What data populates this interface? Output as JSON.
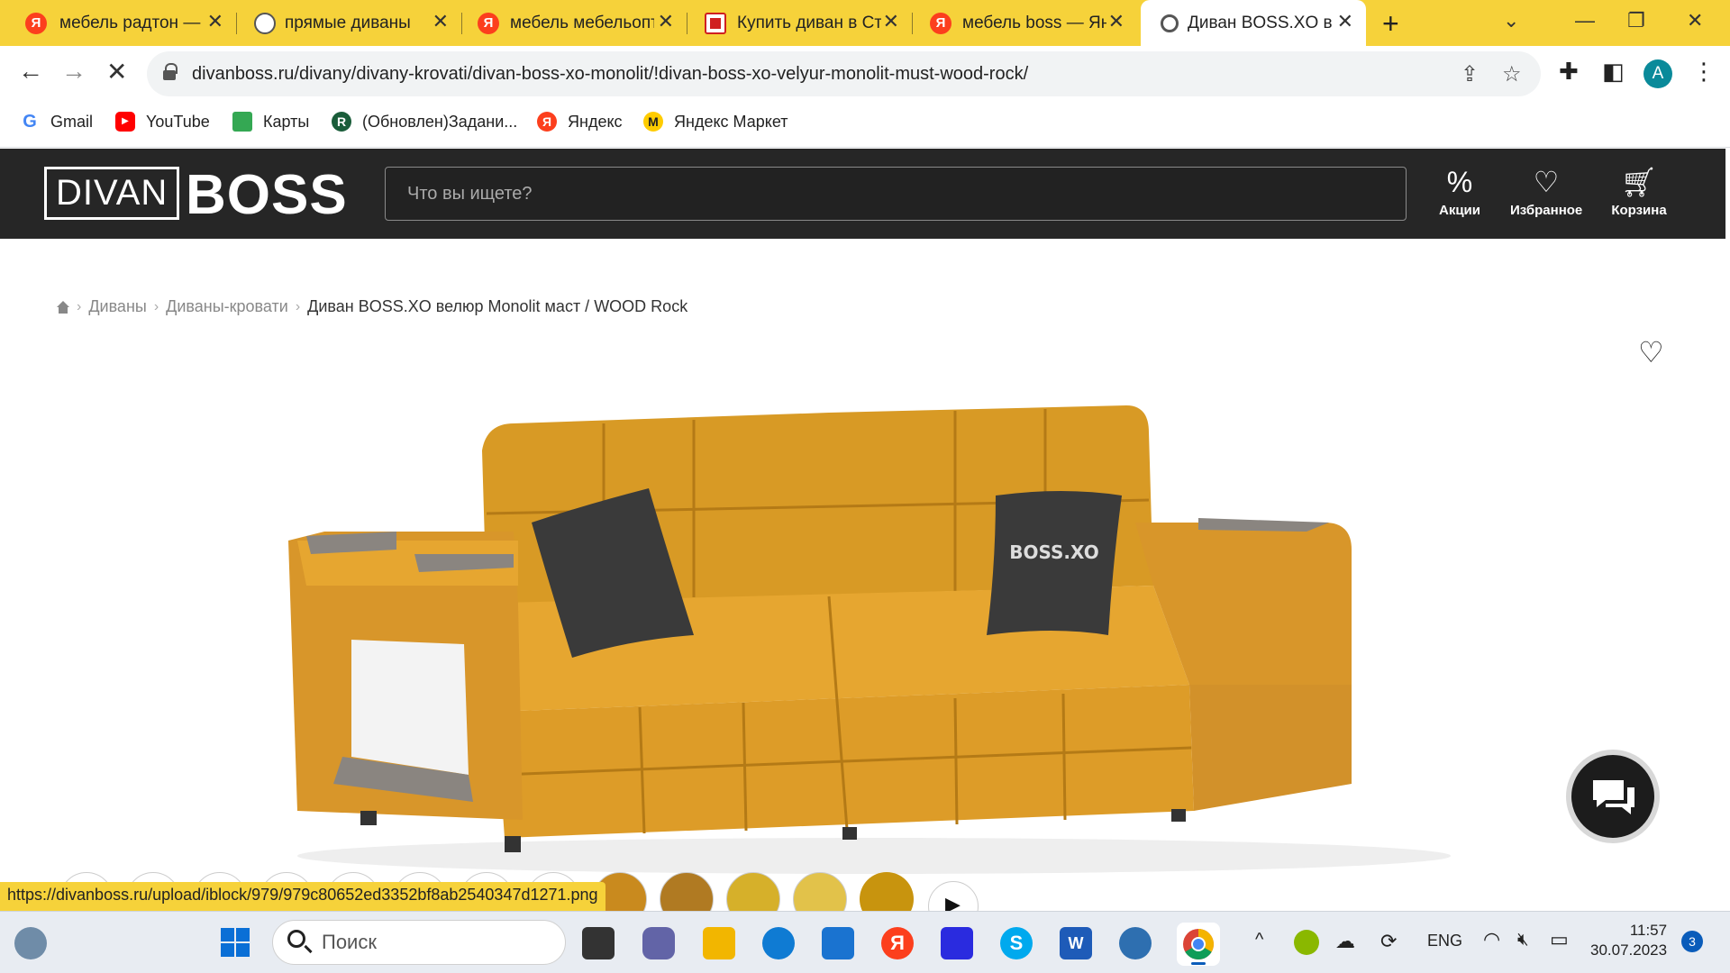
{
  "browser": {
    "tabs": [
      {
        "title": "мебель радтон — Я",
        "favicon": "yandex-icon"
      },
      {
        "title": "прямые диваны",
        "favicon": "globe-icon"
      },
      {
        "title": "мебель мебельопт",
        "favicon": "yandex-icon"
      },
      {
        "title": "Купить диван в Ст",
        "favicon": "store-icon"
      },
      {
        "title": "мебель boss — Янд",
        "favicon": "yandex-icon"
      },
      {
        "title": "Диван BOSS.XO ве",
        "favicon": "divanboss-icon",
        "active": true
      }
    ],
    "new_tab": "+",
    "url": "divanboss.ru/divany/divany-krovati/divan-boss-xo-monolit/!divan-boss-xo-velyur-monolit-must-wood-rock/",
    "profile_initial": "A",
    "bookmarks": [
      {
        "label": "Gmail"
      },
      {
        "label": "YouTube"
      },
      {
        "label": "Карты"
      },
      {
        "label": "(Обновлен)Задани..."
      },
      {
        "label": "Яндекс"
      },
      {
        "label": "Яндекс Маркет"
      }
    ]
  },
  "site": {
    "logo_left": "DIVAN",
    "logo_right": "BOSS",
    "search_placeholder": "Что вы ищете?",
    "actions": {
      "promo": "Акции",
      "favorites": "Избранное",
      "cart": "Корзина"
    },
    "breadcrumb": {
      "items": [
        "Диваны",
        "Диваны-кровати"
      ],
      "current": "Диван BOSS.XO велюр Monolit маст / WOOD Rock"
    },
    "pillow_text": "BOSS.XO",
    "sofa_color": "#e0a12c"
  },
  "status_url": "https://divanboss.ru/upload/iblock/979/979c80652ed3352bf8ab2540347d1271.png",
  "taskbar": {
    "search_placeholder": "Поиск",
    "lang": "ENG",
    "time": "11:57",
    "date": "30.07.2023",
    "notifications": "3"
  }
}
